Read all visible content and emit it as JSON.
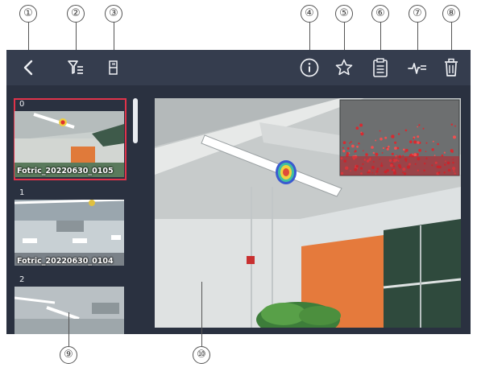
{
  "callouts": [
    "①",
    "②",
    "③",
    "④",
    "⑤",
    "⑥",
    "⑦",
    "⑧",
    "⑨",
    "⑩"
  ],
  "toolbar": {
    "back_icon": "chevron-left-icon",
    "filter_icon": "filter-list-icon",
    "sd_icon": "sd-card-icon",
    "info_icon": "info-circle-icon",
    "favorite_icon": "star-outline-icon",
    "report_icon": "clipboard-report-icon",
    "analysis_icon": "waveform-analysis-icon",
    "delete_icon": "trash-icon"
  },
  "thumbnails": [
    {
      "index": "0",
      "name": "Fotric_20220630_0105",
      "selected": true
    },
    {
      "index": "1",
      "name": "Fotric_20220630_0104",
      "selected": false
    },
    {
      "index": "2",
      "name": "",
      "selected": false
    }
  ],
  "colors": {
    "topbar": "#353d4e",
    "panel": "#2a3140",
    "selection": "#e0334a",
    "icon": "#eef0f4"
  }
}
